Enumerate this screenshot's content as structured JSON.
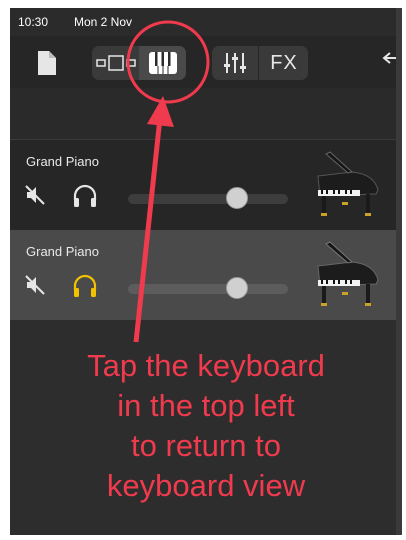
{
  "statusbar": {
    "time": "10:30",
    "date": "Mon 2 Nov"
  },
  "toolbar": {
    "fx_label": "FX",
    "icons": [
      "document-icon",
      "tracks-view-icon",
      "keyboard-icon",
      "mixer-icon",
      "fx-icon",
      "back-icon"
    ]
  },
  "tracks": [
    {
      "name": "Grand Piano",
      "volume": 0.68,
      "headphones_active": false,
      "selected": false
    },
    {
      "name": "Grand Piano",
      "volume": 0.68,
      "headphones_active": true,
      "selected": true
    }
  ],
  "annotation": {
    "lines": [
      "Tap the keyboard",
      "in the top left",
      "to return to",
      "keyboard view"
    ],
    "color": "#f03a4d"
  },
  "colors": {
    "background": "#2b2b2b",
    "headphones_active": "#f2c200",
    "icon": "#e6e6e6",
    "annotation": "#f03a4d"
  }
}
